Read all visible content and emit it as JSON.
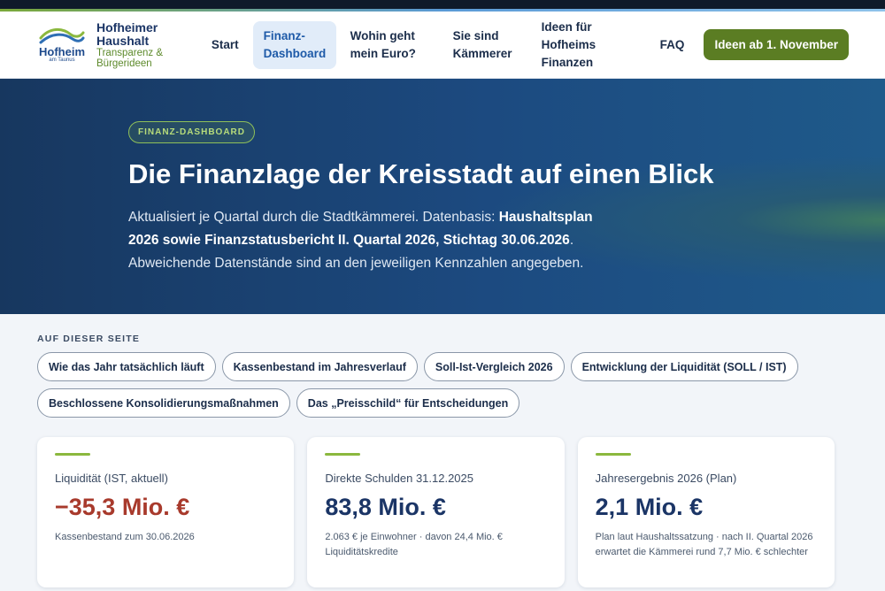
{
  "brand": {
    "logo_word": "Hofheim",
    "logo_sub": "am Taunus",
    "title_line1": "Hofheimer",
    "title_line2": "Haushalt",
    "sub_line1": "Transparenz &",
    "sub_line2": "Bürgerideen"
  },
  "nav": {
    "start": "Start",
    "dashboard_l1": "Finanz-",
    "dashboard_l2": "Dashboard",
    "wohin_l1": "Wohin geht",
    "wohin_l2": "mein Euro?",
    "kaemmerer_l1": "Sie sind",
    "kaemmerer_l2": "Kämmerer",
    "ideen_l1": "Ideen für",
    "ideen_l2": "Hofheims",
    "ideen_l3": "Finanzen",
    "faq": "FAQ",
    "cta": "Ideen ab 1. November"
  },
  "hero": {
    "badge": "FINANZ-DASHBOARD",
    "title": "Die Finanzlage der Kreisstadt auf einen Blick",
    "text_1": "Aktualisiert je Quartal durch die Stadtkämmerei. Datenbasis: ",
    "text_bold": "Haushaltsplan 2026 sowie Finanzstatusbericht II. Quartal 2026, Stichtag 30.06.2026",
    "text_2": ". Abweichende Datenstände sind an den jeweiligen Kennzahlen angegeben."
  },
  "toc": {
    "label": "AUF DIESER SEITE",
    "items": [
      "Wie das Jahr tatsächlich läuft",
      "Kassenbestand im Jahresverlauf",
      "Soll-Ist-Vergleich 2026",
      "Entwicklung der Liquidität (SOLL / IST)",
      "Beschlossene Konsolidierungsmaßnahmen",
      "Das „Preisschild“ für Entscheidungen"
    ]
  },
  "cards": [
    {
      "label": "Liquidität (IST, aktuell)",
      "value": "−35,3 Mio. €",
      "note": "Kassenbestand zum 30.06.2026"
    },
    {
      "label": "Direkte Schulden 31.12.2025",
      "value": "83,8 Mio. €",
      "note": "2.063 € je Einwohner · davon 24,4 Mio. € Liquiditätskredite"
    },
    {
      "label": "Jahresergebnis 2026 (Plan)",
      "value": "2,1 Mio. €",
      "note": "Plan laut Haushaltssatzung · nach II. Quartal 2026 erwartet die Kämmerei rund 7,7 Mio. € schlechter"
    }
  ],
  "colors": {
    "accent_green": "#5b7d23",
    "navy": "#1b3566",
    "negative": "#a83a2c"
  }
}
